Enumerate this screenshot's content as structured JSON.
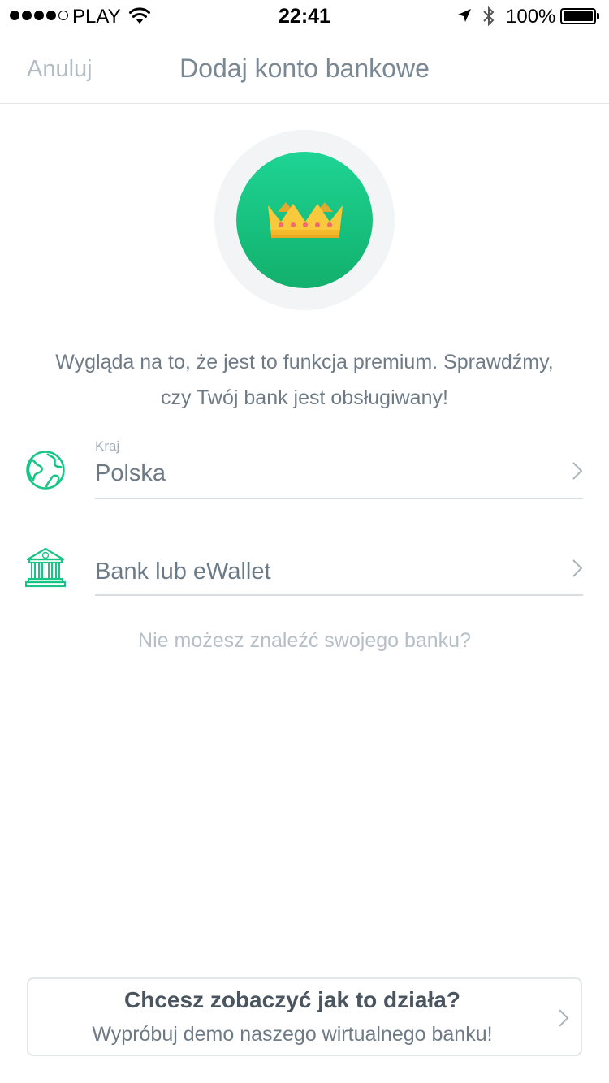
{
  "status_bar": {
    "carrier": "PLAY",
    "time": "22:41",
    "battery": "100%",
    "signal_bars_filled": 4,
    "signal_bars_total": 5,
    "icons": [
      "wifi-icon",
      "location-arrow-icon",
      "bluetooth-icon",
      "battery-icon"
    ]
  },
  "nav": {
    "cancel": "Anuluj",
    "title": "Dodaj konto bankowe"
  },
  "emblem": {
    "icon": "crown-icon",
    "accent_color": "#18c585"
  },
  "intro": {
    "line1": "Wygląda na to, że jest to funkcja premium. Sprawdźmy,",
    "line2": "czy Twój bank jest obsługiwany!"
  },
  "form": {
    "country": {
      "icon": "globe-icon",
      "label": "Kraj",
      "value": "Polska"
    },
    "bank": {
      "icon": "bank-icon",
      "placeholder": "Bank lub eWallet"
    }
  },
  "cant_find": "Nie możesz znaleźć swojego banku?",
  "demo": {
    "title": "Chcesz zobaczyć jak to działa?",
    "subtitle": "Wypróbuj demo naszego wirtualnego banku!"
  }
}
